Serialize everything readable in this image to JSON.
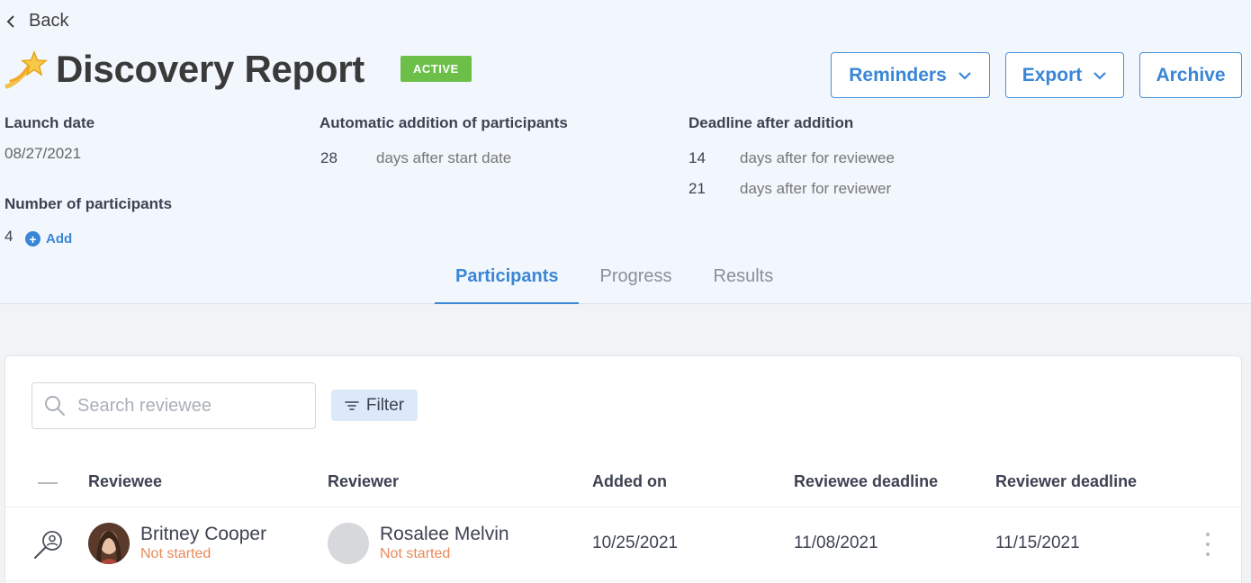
{
  "nav": {
    "back_label": "Back"
  },
  "header": {
    "title": "Discovery Report",
    "status_badge": "ACTIVE"
  },
  "actions": {
    "reminders_label": "Reminders",
    "export_label": "Export",
    "archive_label": "Archive"
  },
  "meta": {
    "launch_date_label": "Launch date",
    "launch_date_value": "08/27/2021",
    "participants_label": "Number of participants",
    "participants_count": "4",
    "add_label": "Add",
    "auto_addition_label": "Automatic addition of participants",
    "auto_addition_num": "28",
    "auto_addition_desc": "days after start date",
    "deadline_label": "Deadline after addition",
    "deadline_reviewee_num": "14",
    "deadline_reviewee_desc": "days after for reviewee",
    "deadline_reviewer_num": "21",
    "deadline_reviewer_desc": "days after for reviewer"
  },
  "tabs": [
    {
      "label": "Participants",
      "active": true
    },
    {
      "label": "Progress",
      "active": false
    },
    {
      "label": "Results",
      "active": false
    }
  ],
  "toolbar": {
    "search_placeholder": "Search reviewee",
    "filter_label": "Filter"
  },
  "table": {
    "columns": [
      "Reviewee",
      "Reviewer",
      "Added on",
      "Reviewee deadline",
      "Reviewer deadline"
    ],
    "rows": [
      {
        "reviewee_name": "Britney Cooper",
        "reviewee_status": "Not started",
        "reviewer_name": "Rosalee Melvin",
        "reviewer_status": "Not started",
        "added_on": "10/25/2021",
        "reviewee_deadline": "11/08/2021",
        "reviewer_deadline": "11/15/2021"
      }
    ]
  },
  "colors": {
    "accent": "#3a86d6",
    "badge_active": "#6cc04a",
    "status_not_started": "#e88a5a",
    "header_bg": "#f1f7fc"
  },
  "icons": {
    "back": "chevron-left-icon",
    "title": "shooting-star-icon",
    "dropdown": "chevron-down-icon",
    "add": "plus-circle-icon",
    "search": "search-icon",
    "filter": "filter-lines-icon",
    "row_view": "user-search-icon",
    "more": "kebab-menu-icon"
  }
}
